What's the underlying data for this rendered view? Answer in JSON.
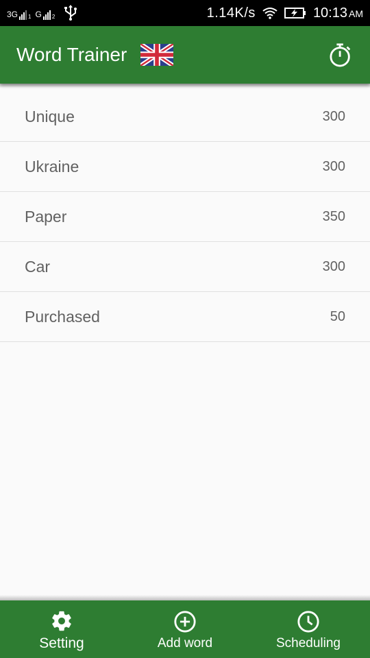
{
  "status_bar": {
    "net1_label": "3G",
    "net2_label": "G",
    "sim1": "1",
    "sim2": "2",
    "speed": "1.14K/s",
    "time": "10:13",
    "ampm": "AM",
    "icons": [
      "signal-icon",
      "usb-icon",
      "wifi-icon",
      "battery-charging-icon"
    ]
  },
  "app_bar": {
    "title": "Word Trainer",
    "flag_icon": "uk-flag-icon",
    "timer_icon": "stopwatch-icon",
    "color": "#2e7d32"
  },
  "words": [
    {
      "word": "Unique",
      "count": "300"
    },
    {
      "word": "Ukraine",
      "count": "300"
    },
    {
      "word": "Paper",
      "count": "350"
    },
    {
      "word": "Car",
      "count": "300"
    },
    {
      "word": "Purchased",
      "count": "50"
    }
  ],
  "bottom_nav": {
    "items": [
      {
        "label": "Setting",
        "icon": "gear-icon",
        "active": true
      },
      {
        "label": "Add word",
        "icon": "add-circle-icon",
        "active": false
      },
      {
        "label": "Scheduling",
        "icon": "clock-icon",
        "active": false
      }
    ]
  }
}
